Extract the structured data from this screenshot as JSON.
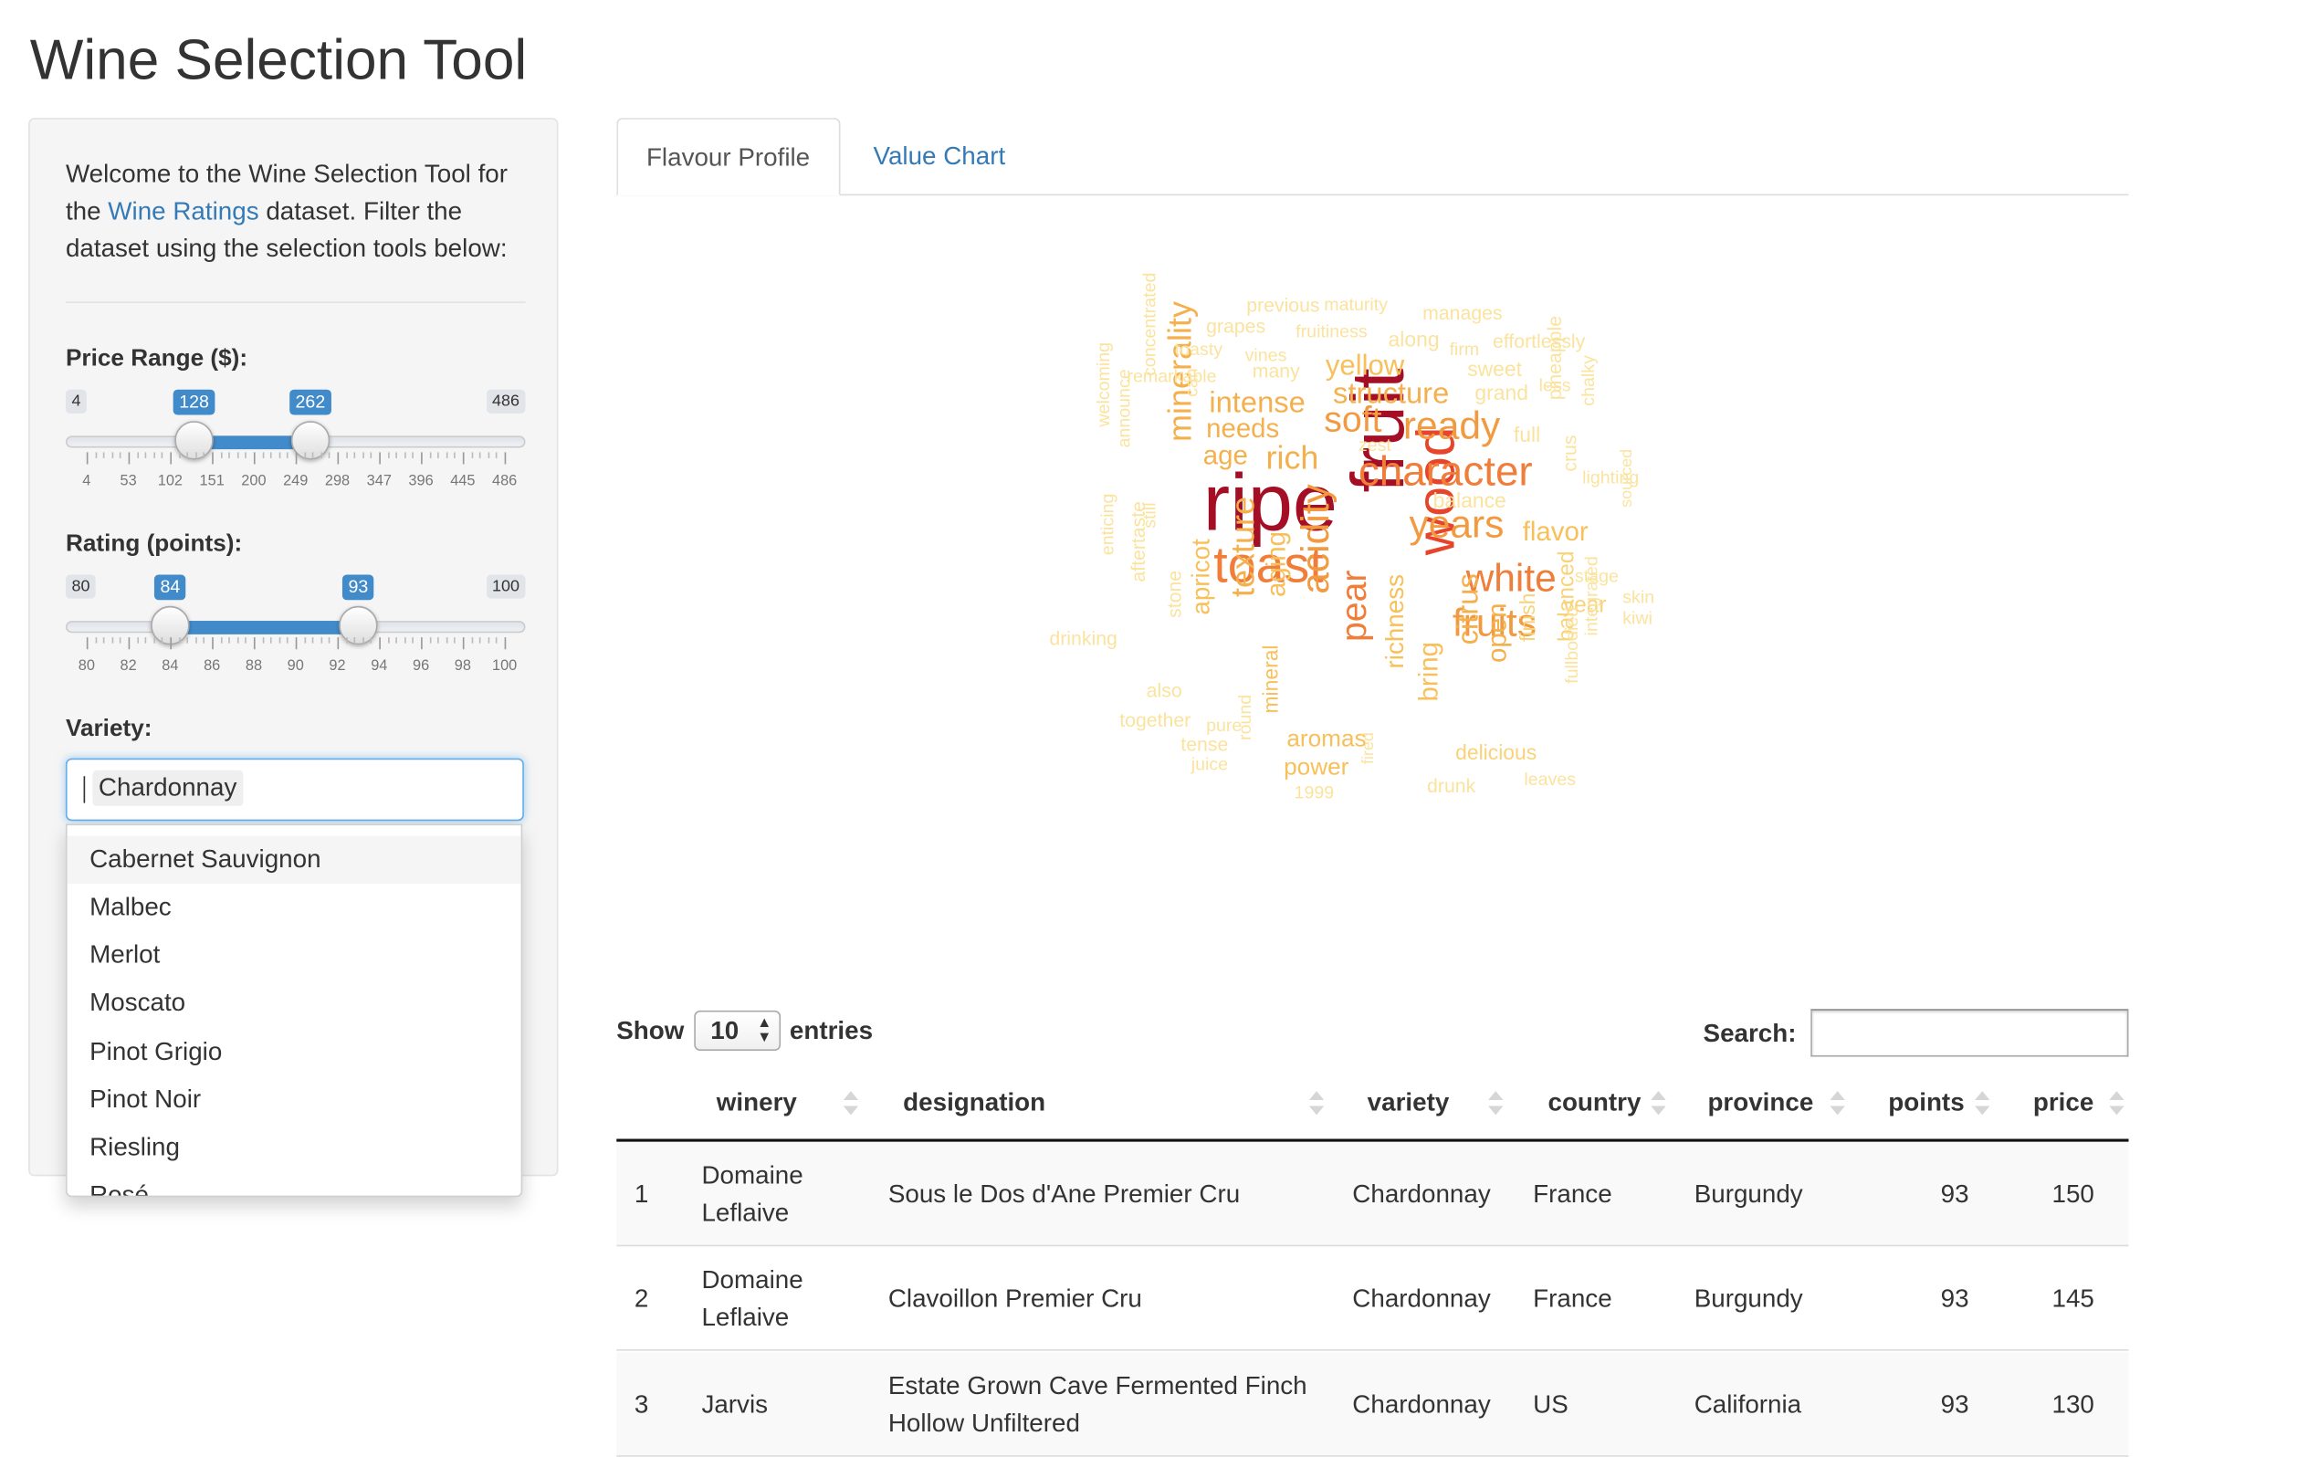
{
  "app": {
    "title": "Wine Selection Tool"
  },
  "sidebar": {
    "intro_before": "Welcome to the Wine Selection Tool for the ",
    "intro_link": "Wine Ratings",
    "intro_after": " dataset. Filter the dataset using the selection tools below:",
    "price": {
      "label": "Price Range ($):",
      "min": "4",
      "max": "486",
      "from": "128",
      "to": "262",
      "min_value": 4,
      "max_value": 486,
      "from_value": 128,
      "to_value": 262,
      "grid": [
        "4",
        "53",
        "102",
        "151",
        "200",
        "249",
        "298",
        "347",
        "396",
        "445",
        "486"
      ]
    },
    "rating": {
      "label": "Rating (points):",
      "min": "80",
      "max": "100",
      "from": "84",
      "to": "93",
      "min_value": 80,
      "max_value": 100,
      "from_value": 84,
      "to_value": 93,
      "grid": [
        "80",
        "82",
        "84",
        "86",
        "88",
        "90",
        "92",
        "94",
        "96",
        "98",
        "100"
      ]
    },
    "variety": {
      "label": "Variety:",
      "selected": "Chardonnay",
      "options": [
        "Cabernet Sauvignon",
        "Malbec",
        "Merlot",
        "Moscato",
        "Pinot Grigio",
        "Pinot Noir",
        "Riesling",
        "Rosé"
      ],
      "highlighted_option": "Cabernet Sauvignon"
    }
  },
  "tabs": [
    {
      "label": "Flavour Profile",
      "active": true
    },
    {
      "label": "Value Chart",
      "active": false
    }
  ],
  "wordcloud": {
    "words": [
      {
        "text": "ripe",
        "color": "#a50f26"
      },
      {
        "text": "fruit",
        "color": "#a50f26"
      },
      {
        "text": "wood",
        "color": "#e6452c"
      },
      {
        "text": "toast",
        "color": "#f07d3a"
      },
      {
        "text": "character",
        "color": "#f07d3a"
      },
      {
        "text": "ready",
        "color": "#f29a40"
      },
      {
        "text": "soft",
        "color": "#f29a40"
      },
      {
        "text": "white",
        "color": "#f07d3a"
      },
      {
        "text": "years",
        "color": "#f29a40"
      },
      {
        "text": "fruits",
        "color": "#f29a40"
      },
      {
        "text": "acidity",
        "color": "#f29a40"
      },
      {
        "text": "pear",
        "color": "#f07d3a"
      },
      {
        "text": "texture",
        "color": "#f5b04e"
      },
      {
        "text": "minerality",
        "color": "#f5b04e"
      },
      {
        "text": "rich",
        "color": "#f5b04e"
      },
      {
        "text": "intense",
        "color": "#f5b04e"
      },
      {
        "text": "structure",
        "color": "#f5b04e"
      },
      {
        "text": "needs",
        "color": "#f5b04e"
      },
      {
        "text": "age",
        "color": "#f5b04e"
      },
      {
        "text": "yellow",
        "color": "#f7c05a"
      },
      {
        "text": "flavor",
        "color": "#f7c05a"
      },
      {
        "text": "citrus",
        "color": "#f5b04e"
      },
      {
        "text": "open",
        "color": "#f5b04e"
      },
      {
        "text": "bring",
        "color": "#f7c05a"
      },
      {
        "text": "aging",
        "color": "#f7c05a"
      },
      {
        "text": "richness",
        "color": "#f7c05a"
      },
      {
        "text": "apricot",
        "color": "#f7c05a"
      },
      {
        "text": "aromas",
        "color": "#f7c05a"
      },
      {
        "text": "power",
        "color": "#f7c05a"
      },
      {
        "text": "mineral",
        "color": "#f7c05a"
      },
      {
        "text": "delicious",
        "color": "#f9d37a"
      },
      {
        "text": "balanced",
        "color": "#f9d37a"
      },
      {
        "text": "finish",
        "color": "#f9d37a"
      },
      {
        "text": "year",
        "color": "#f9d37a"
      },
      {
        "text": "balance",
        "color": "#fbe39e"
      },
      {
        "text": "full",
        "color": "#fbe39e"
      },
      {
        "text": "zest",
        "color": "#fbe39e"
      },
      {
        "text": "grand",
        "color": "#fbe39e"
      },
      {
        "text": "sweet",
        "color": "#fbe39e"
      },
      {
        "text": "along",
        "color": "#fbe39e"
      },
      {
        "text": "firm",
        "color": "#fbe39e"
      },
      {
        "text": "effortlessly",
        "color": "#fbe39e"
      },
      {
        "text": "manages",
        "color": "#fbe39e"
      },
      {
        "text": "previous",
        "color": "#fbe39e"
      },
      {
        "text": "maturity",
        "color": "#fbe39e"
      },
      {
        "text": "grapes",
        "color": "#fbe39e"
      },
      {
        "text": "fruitiness",
        "color": "#fbe39e"
      },
      {
        "text": "toasty",
        "color": "#fbe39e"
      },
      {
        "text": "vines",
        "color": "#fbe39e"
      },
      {
        "text": "many",
        "color": "#fbe39e"
      },
      {
        "text": "remarkable",
        "color": "#fbe39e"
      },
      {
        "text": "less",
        "color": "#fbe39e"
      },
      {
        "text": "pineapple",
        "color": "#fbe39e"
      },
      {
        "text": "chalky",
        "color": "#fbe39e"
      },
      {
        "text": "crus",
        "color": "#fbe39e"
      },
      {
        "text": "lighting",
        "color": "#fbe39e"
      },
      {
        "text": "stage",
        "color": "#fbe39e"
      },
      {
        "text": "skin",
        "color": "#fbe39e"
      },
      {
        "text": "kiwi",
        "color": "#fbe39e"
      },
      {
        "text": "integrated",
        "color": "#fbe39e"
      },
      {
        "text": "fullbodied",
        "color": "#fbe39e"
      },
      {
        "text": "leaves",
        "color": "#fbe39e"
      },
      {
        "text": "drunk",
        "color": "#fbe39e"
      },
      {
        "text": "1999",
        "color": "#fbe39e"
      },
      {
        "text": "juice",
        "color": "#fbe39e"
      },
      {
        "text": "tense",
        "color": "#fbe39e"
      },
      {
        "text": "pure",
        "color": "#fbe39e"
      },
      {
        "text": "together",
        "color": "#fbe39e"
      },
      {
        "text": "also",
        "color": "#fbe39e"
      },
      {
        "text": "stone",
        "color": "#fbe39e"
      },
      {
        "text": "aftertaste",
        "color": "#fbe39e"
      },
      {
        "text": "drinking",
        "color": "#fbe39e"
      },
      {
        "text": "enticing",
        "color": "#fbe39e"
      },
      {
        "text": "still",
        "color": "#fbe39e"
      },
      {
        "text": "can",
        "color": "#fbe39e"
      },
      {
        "text": "welcoming",
        "color": "#fbe39e"
      },
      {
        "text": "announce",
        "color": "#fbe39e"
      },
      {
        "text": "concentrated",
        "color": "#fbe39e"
      },
      {
        "text": "round",
        "color": "#fbe39e"
      },
      {
        "text": "fired",
        "color": "#fbe39e"
      },
      {
        "text": "sourced",
        "color": "#fbe39e"
      }
    ]
  },
  "table": {
    "length_label_before": "Show",
    "length_value": "10",
    "length_label_after": "entries",
    "search_label": "Search:",
    "columns": [
      "",
      "winery",
      "designation",
      "variety",
      "country",
      "province",
      "points",
      "price"
    ],
    "rows": [
      [
        "1",
        "Domaine Leflaive",
        "Sous le Dos d'Ane Premier Cru",
        "Chardonnay",
        "France",
        "Burgundy",
        "93",
        "150"
      ],
      [
        "2",
        "Domaine Leflaive",
        "Clavoillon Premier Cru",
        "Chardonnay",
        "France",
        "Burgundy",
        "93",
        "145"
      ],
      [
        "3",
        "Jarvis",
        "Estate Grown Cave Fermented Finch Hollow Unfiltered",
        "Chardonnay",
        "US",
        "California",
        "93",
        "130"
      ]
    ]
  }
}
